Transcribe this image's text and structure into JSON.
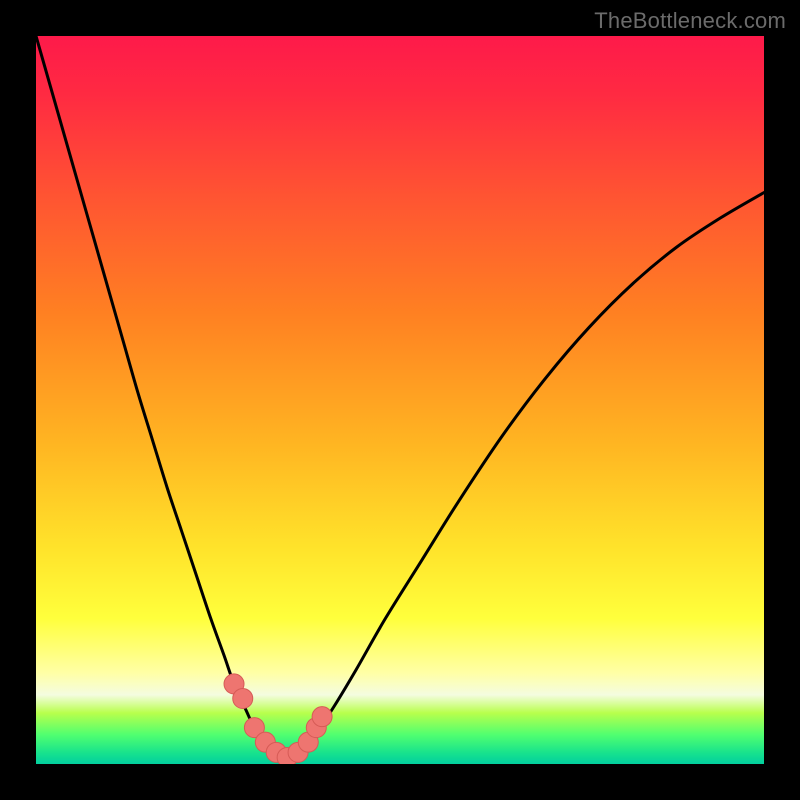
{
  "watermark": "TheBottleneck.com",
  "colors": {
    "frame": "#000000",
    "curve_stroke": "#000000",
    "marker_fill": "#ee7570",
    "marker_stroke": "#d65b56",
    "gradient_stops": [
      "#fe1a4a",
      "#ff2a42",
      "#ff5432",
      "#ff8022",
      "#ffb522",
      "#ffe22a",
      "#ffff3c",
      "#ffffa6",
      "#f4fce0",
      "#b8ff4c",
      "#50ff70",
      "#17e28d",
      "#02cf9f"
    ]
  },
  "chart_data": {
    "type": "line",
    "title": "",
    "xlabel": "",
    "ylabel": "",
    "xlim": [
      0,
      100
    ],
    "ylim": [
      0,
      100
    ],
    "grid": false,
    "series": [
      {
        "name": "left-branch",
        "x": [
          0,
          2,
          4,
          6,
          8,
          10,
          12,
          14,
          16,
          18,
          20,
          22,
          24,
          25.8,
          27.2,
          28.8,
          30.0,
          31.5,
          33.0,
          34.5
        ],
        "y": [
          100,
          93,
          86,
          79,
          72,
          65,
          58,
          51,
          44.5,
          38,
          32,
          26,
          20,
          15,
          11,
          7.5,
          5.0,
          3.0,
          1.6,
          0.9
        ]
      },
      {
        "name": "right-branch",
        "x": [
          34.5,
          36.0,
          37.5,
          39.0,
          41.0,
          44.0,
          48.0,
          53.0,
          58.0,
          64.0,
          70.0,
          76.0,
          82.0,
          88.0,
          94.0,
          100.0
        ],
        "y": [
          0.9,
          1.6,
          3.0,
          5.0,
          8.0,
          13.0,
          20.0,
          28.0,
          36.0,
          45.0,
          53.0,
          60.0,
          66.0,
          71.0,
          75.0,
          78.5
        ]
      },
      {
        "name": "bottom-marker",
        "x": [
          27.2,
          28.4,
          30.0,
          31.5,
          33.0,
          34.5,
          36.0,
          37.4,
          38.5,
          39.3
        ],
        "y": [
          11.0,
          9.0,
          5.0,
          3.0,
          1.6,
          0.9,
          1.6,
          3.0,
          5.0,
          6.5
        ]
      }
    ],
    "markers": {
      "series": "bottom-marker",
      "shape": "circle",
      "size": 20
    }
  }
}
